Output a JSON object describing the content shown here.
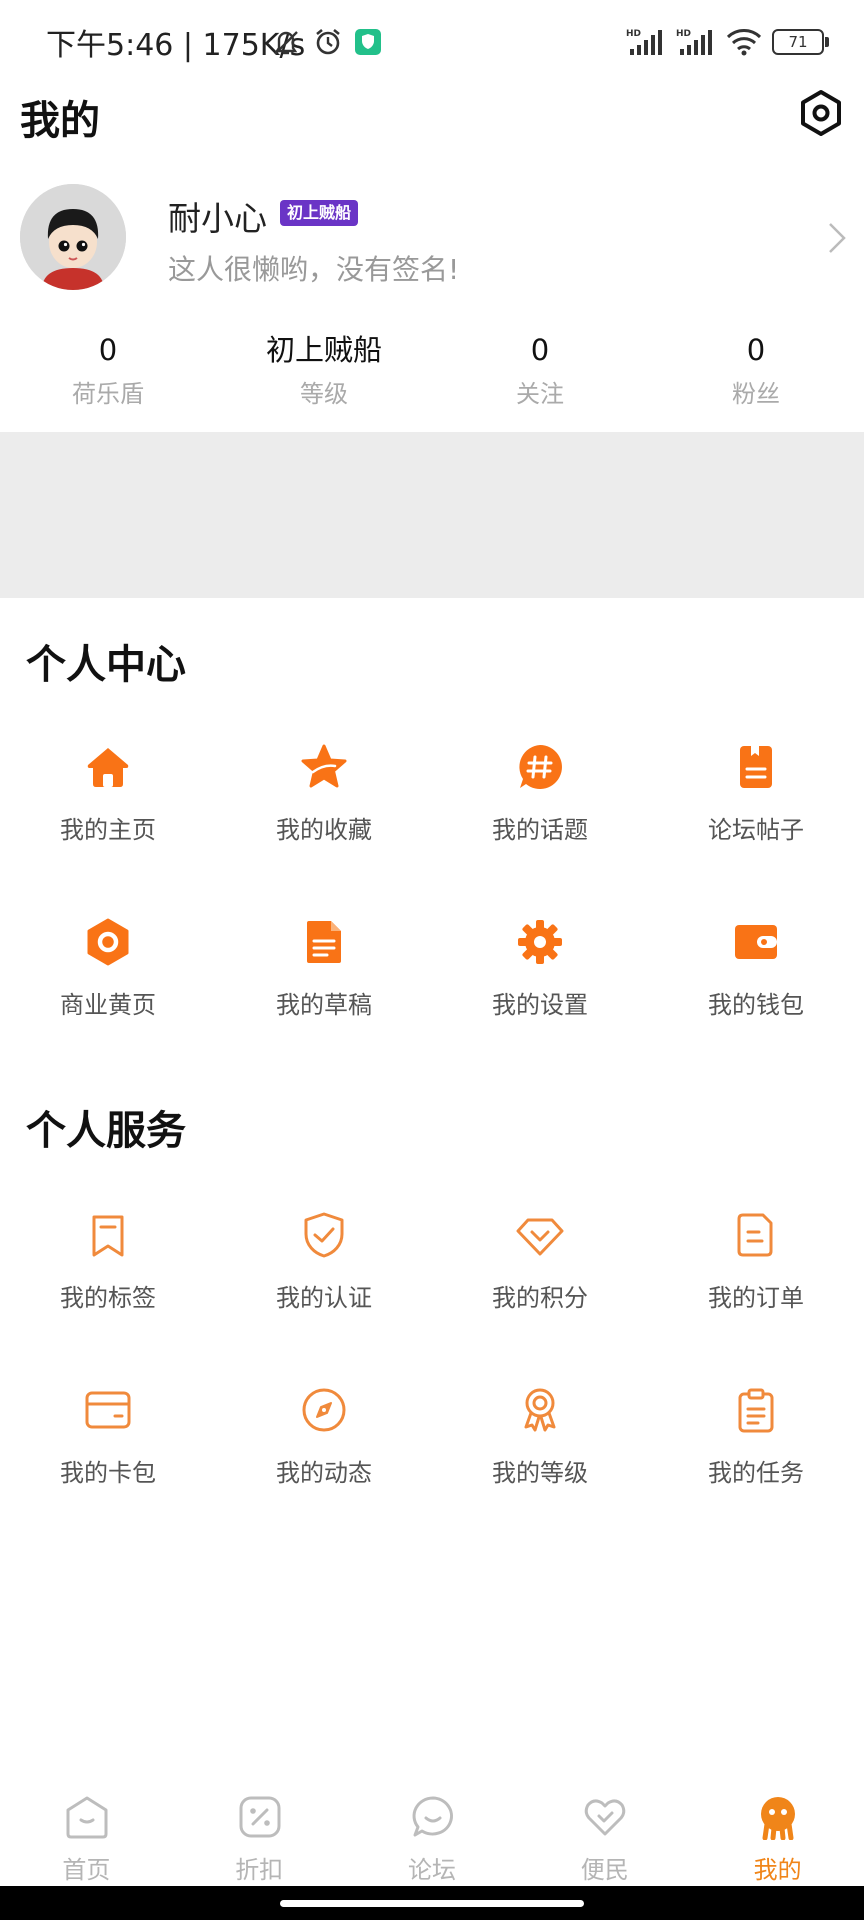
{
  "status_bar": {
    "time": "下午5:46 | 175K/s",
    "battery": "71",
    "icons": [
      "mute-icon",
      "alarm-icon",
      "vpn-shield-icon",
      "hd-signal-icon",
      "hd-signal-icon",
      "wifi-icon",
      "battery-icon"
    ]
  },
  "header": {
    "title": "我的",
    "settings_icon": "settings-hexagon-icon"
  },
  "profile": {
    "username": "耐小心",
    "level_badge": "初上贼船",
    "signature": "这人很懒哟，没有签名!"
  },
  "stats": [
    {
      "value": "0",
      "label": "荷乐盾"
    },
    {
      "value": "初上贼船",
      "label": "等级"
    },
    {
      "value": "0",
      "label": "关注"
    },
    {
      "value": "0",
      "label": "粉丝"
    }
  ],
  "personal_center": {
    "title": "个人中心",
    "items": [
      {
        "label": "我的主页",
        "icon": "home-icon"
      },
      {
        "label": "我的收藏",
        "icon": "star-icon"
      },
      {
        "label": "我的话题",
        "icon": "hashtag-icon"
      },
      {
        "label": "论坛帖子",
        "icon": "post-icon"
      },
      {
        "label": "商业黄页",
        "icon": "hexagon-icon"
      },
      {
        "label": "我的草稿",
        "icon": "draft-icon"
      },
      {
        "label": "我的设置",
        "icon": "gear-icon"
      },
      {
        "label": "我的钱包",
        "icon": "wallet-icon"
      }
    ]
  },
  "personal_services": {
    "title": "个人服务",
    "items": [
      {
        "label": "我的标签",
        "icon": "bookmark-icon"
      },
      {
        "label": "我的认证",
        "icon": "shield-check-icon"
      },
      {
        "label": "我的积分",
        "icon": "diamond-icon"
      },
      {
        "label": "我的订单",
        "icon": "order-icon"
      },
      {
        "label": "我的卡包",
        "icon": "card-icon"
      },
      {
        "label": "我的动态",
        "icon": "compass-icon"
      },
      {
        "label": "我的等级",
        "icon": "medal-icon"
      },
      {
        "label": "我的任务",
        "icon": "clipboard-icon"
      }
    ]
  },
  "tabbar": {
    "active_color": "#f08519",
    "items": [
      {
        "label": "首页",
        "icon": "home-tab-icon"
      },
      {
        "label": "折扣",
        "icon": "discount-tab-icon"
      },
      {
        "label": "论坛",
        "icon": "forum-tab-icon"
      },
      {
        "label": "便民",
        "icon": "heart-tab-icon"
      },
      {
        "label": "我的",
        "icon": "profile-tab-icon",
        "active": true
      }
    ]
  },
  "colors": {
    "accent": "#f08519",
    "icon_orange": "#f97316",
    "badge_purple": "#6a34c6"
  }
}
